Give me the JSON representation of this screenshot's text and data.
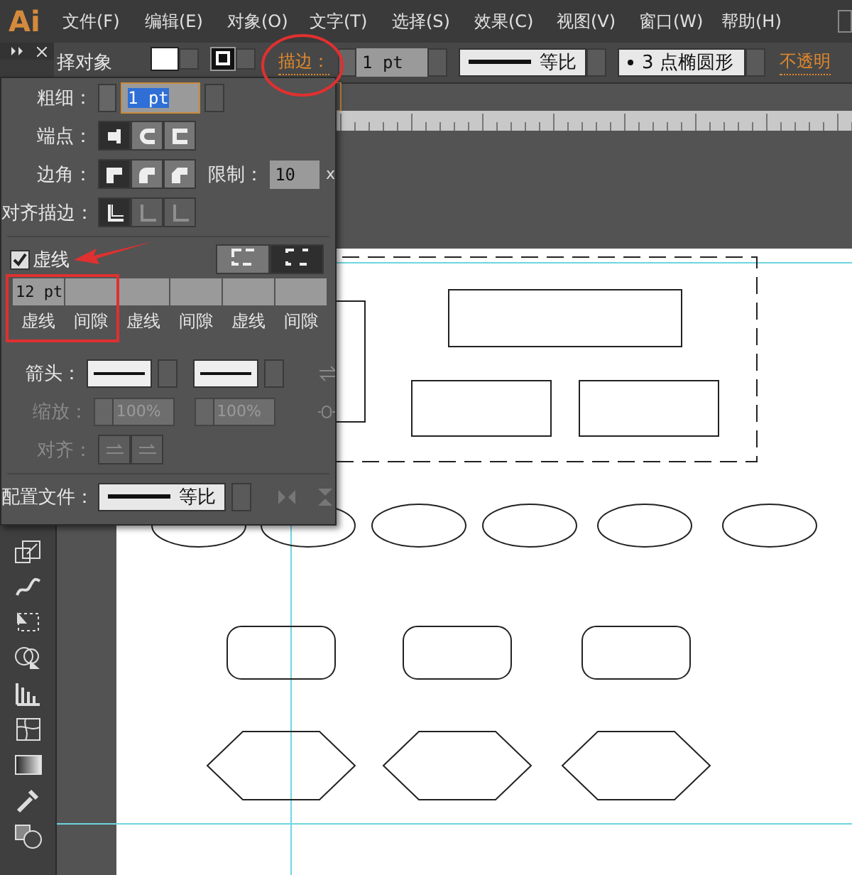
{
  "menu_bar": {
    "logo": "Ai",
    "items": [
      "文件(F)",
      "编辑(E)",
      "对象(O)",
      "文字(T)",
      "选择(S)",
      "效果(C)",
      "视图(V)",
      "窗口(W)",
      "帮助(H)"
    ]
  },
  "control_bar": {
    "selection_label": "择对象",
    "stroke_link": "描边：",
    "stroke_weight": "1 pt",
    "profile": "等比",
    "brush": "3 点椭圆形",
    "opacity_link": "不透明"
  },
  "stroke_panel": {
    "weight": {
      "label": "粗细：",
      "value": "1 pt"
    },
    "cap": {
      "label": "端点：",
      "buttons": [
        {
          "selected": true
        },
        {
          "selected": false
        },
        {
          "selected": false
        }
      ]
    },
    "corner": {
      "label": "边角：",
      "buttons": [
        {
          "selected": true
        },
        {
          "selected": false
        },
        {
          "selected": false
        }
      ],
      "limit_label": "限制：",
      "limit": "10",
      "limit_unit": "x"
    },
    "align": {
      "label": "对齐描边：",
      "buttons": [
        {
          "selected": true,
          "disabled": false
        },
        {
          "selected": false,
          "disabled": true
        },
        {
          "selected": false,
          "disabled": true
        }
      ]
    },
    "dashed": {
      "label": "虚线",
      "checked": true,
      "modes": [
        {
          "selected": false
        },
        {
          "selected": true
        }
      ]
    },
    "dash_fields": [
      {
        "value": "12 pt",
        "label": "虚线"
      },
      {
        "label": "间隙"
      },
      {
        "label": "虚线"
      },
      {
        "label": "间隙"
      },
      {
        "label": "虚线"
      },
      {
        "label": "间隙"
      }
    ],
    "arrowheads": {
      "label": "箭头："
    },
    "scale": {
      "label": "缩放：",
      "values": [
        "100%",
        "100%"
      ],
      "disabled": true
    },
    "arrow_align": {
      "label": "对齐：",
      "disabled": true
    },
    "profile": {
      "label": "配置文件：",
      "value": "等比"
    }
  }
}
